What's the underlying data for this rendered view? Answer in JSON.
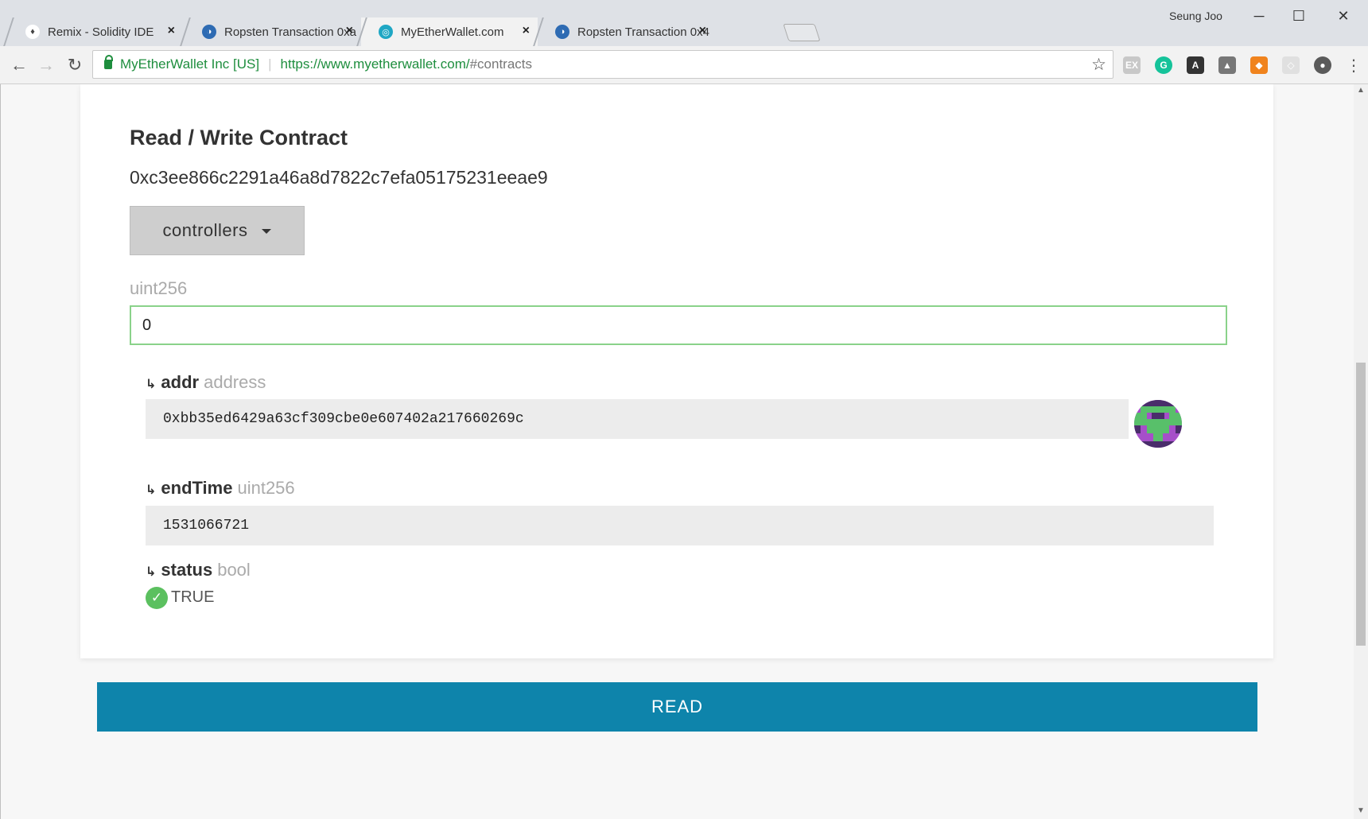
{
  "browser": {
    "tabs": [
      {
        "title": "Remix - Solidity IDE",
        "close": "×"
      },
      {
        "title": "Ropsten Transaction 0xa",
        "close": "×"
      },
      {
        "title": "MyEtherWallet.com",
        "close": "×"
      },
      {
        "title": "Ropsten Transaction 0x4",
        "close": "×"
      }
    ],
    "user_name": "Seung Joo",
    "window_controls": {
      "minimize": "─",
      "maximize": "☐",
      "close": "✕"
    },
    "nav": {
      "back": "←",
      "forward": "→",
      "reload": "↻"
    },
    "address_bar": {
      "org": "MyEtherWallet Inc [US]",
      "separator": "|",
      "url_scheme_host": "https://www.myetherwallet.com/",
      "url_path": "#contracts",
      "star": "☆"
    },
    "menu": "⋮",
    "extension_icons": [
      "ex-icon",
      "grammarly-icon",
      "a-icon",
      "bookmark-icon",
      "metamask-icon",
      "shield-icon",
      "evernote-icon"
    ]
  },
  "contract": {
    "title": "Read / Write Contract",
    "address": "0xc3ee866c2291a46a8d7822c7efa05175231eeae9",
    "function_dropdown": "controllers",
    "input": {
      "type_label": "uint256",
      "value": "0"
    },
    "outputs": {
      "addr": {
        "name": "addr",
        "type": "address",
        "value": "0xbb35ed6429a63cf309cbe0e607402a217660269c"
      },
      "endTime": {
        "name": "endTime",
        "type": "uint256",
        "value": "1531066721"
      },
      "status": {
        "name": "status",
        "type": "bool",
        "value": "TRUE"
      }
    },
    "arrow_glyph": "↳",
    "read_button": "READ"
  },
  "colors": {
    "accent_button": "#0e84ab",
    "success_green": "#5bc05f",
    "input_border": "#8ad28a"
  }
}
